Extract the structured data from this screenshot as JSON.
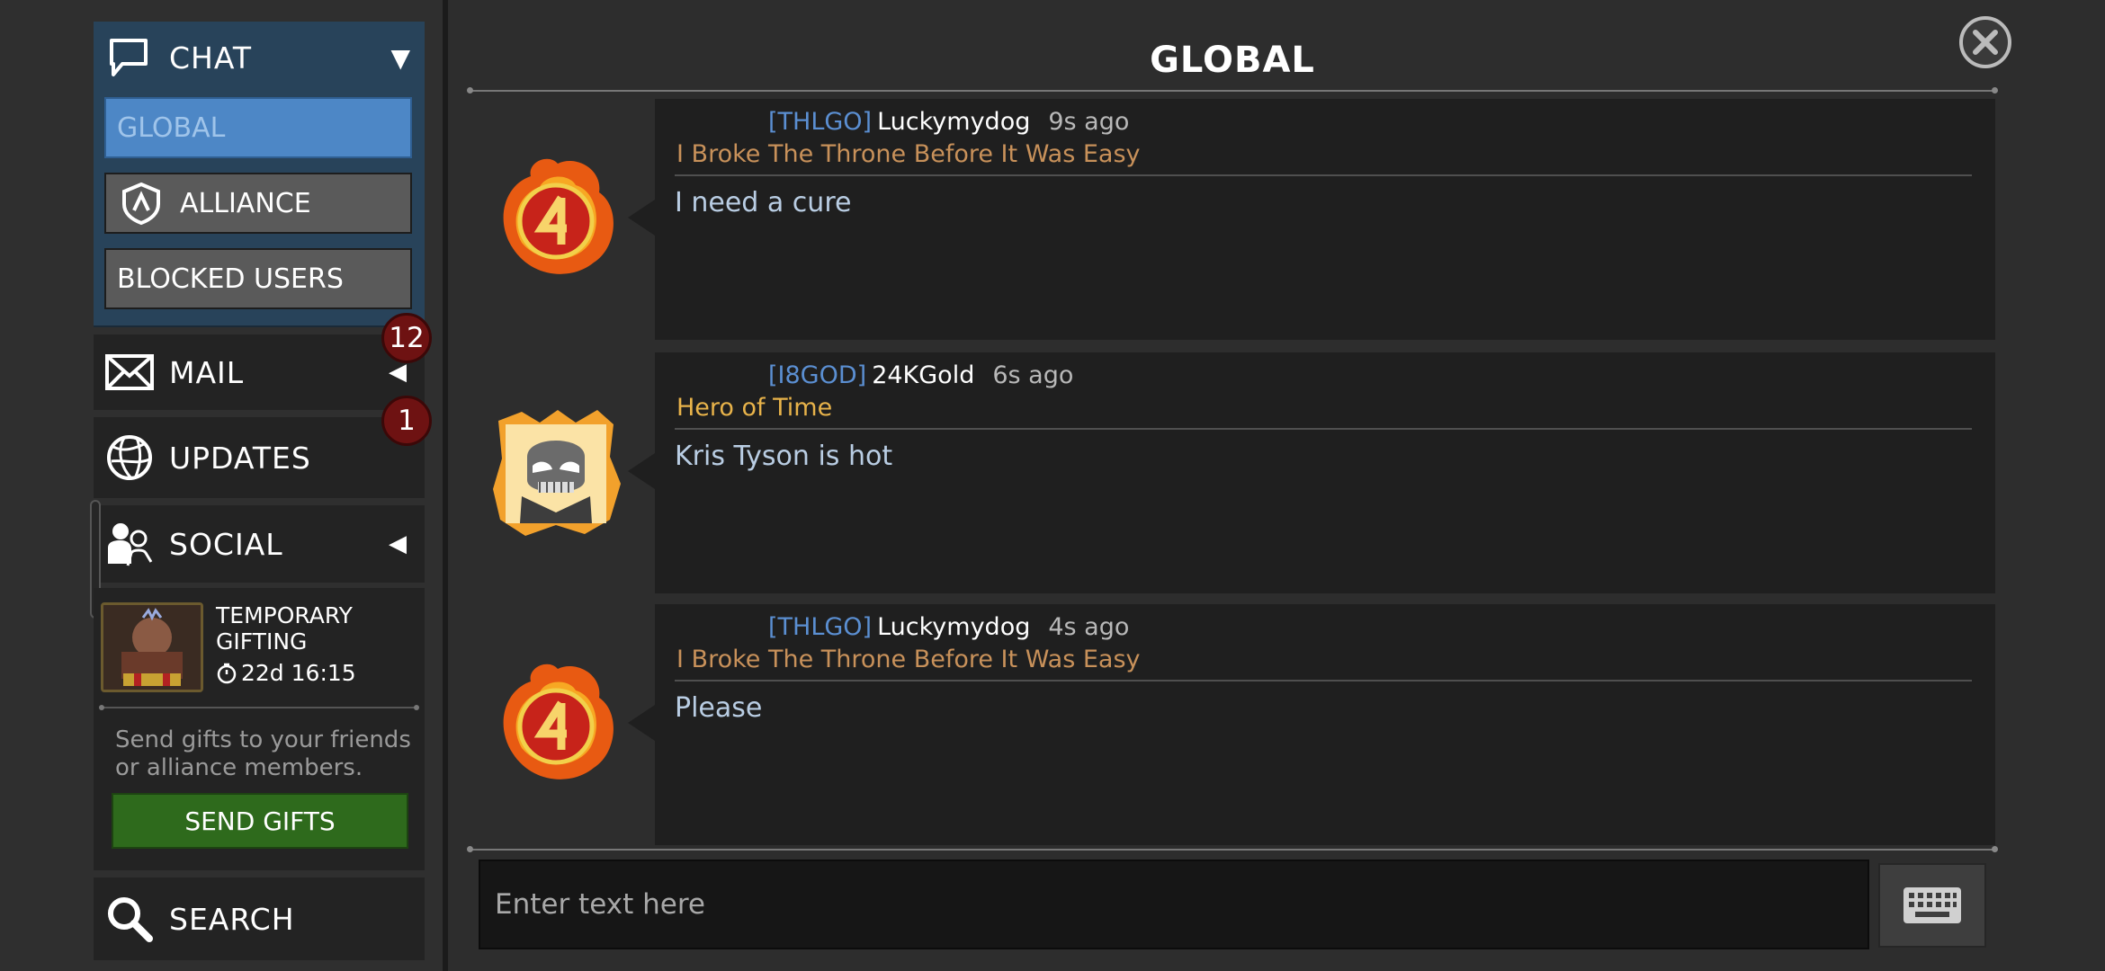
{
  "sidebar": {
    "chat": {
      "label": "CHAT",
      "icon": "speech-bubble-icon",
      "toggle": "▼"
    },
    "chat_sub": {
      "global": "GLOBAL",
      "alliance": "ALLIANCE",
      "blocked": "BLOCKED USERS"
    },
    "mail": {
      "label": "MAIL",
      "badge": "12",
      "toggle": "◀"
    },
    "updates": {
      "label": "UPDATES",
      "badge": "1"
    },
    "social": {
      "label": "SOCIAL",
      "toggle": "◀"
    },
    "search": {
      "label": "SEARCH"
    }
  },
  "gifting": {
    "title": "TEMPORARY GIFTING",
    "timer": "22d 16:15",
    "description": "Send gifts to your friends or alliance members.",
    "button": "SEND GIFTS"
  },
  "main": {
    "title": "GLOBAL",
    "input_placeholder": "Enter text here",
    "messages": [
      {
        "tag": "[THLGO]",
        "user": "Luckymydog",
        "time": "9s ago",
        "user_title": "I Broke The Throne Before It Was Easy",
        "title_color": "#c8915a",
        "text": "I need a cure",
        "avatar": "flaming-four-icon"
      },
      {
        "tag": "[I8GOD]",
        "user": "24KGold",
        "time": "6s ago",
        "user_title": "Hero of Time",
        "title_color": "#e8b34a",
        "text": "Kris Tyson is hot",
        "avatar": "skull-mask-hero-icon"
      },
      {
        "tag": "[THLGO]",
        "user": "Luckymydog",
        "time": "4s ago",
        "user_title": "I Broke The Throne Before It Was Easy",
        "title_color": "#c8915a",
        "text": "Please",
        "avatar": "flaming-four-icon"
      }
    ]
  },
  "colors": {
    "accent_blue": "#4d87c6",
    "badge_red": "#6e1212",
    "send_green": "#2e6a1c"
  }
}
